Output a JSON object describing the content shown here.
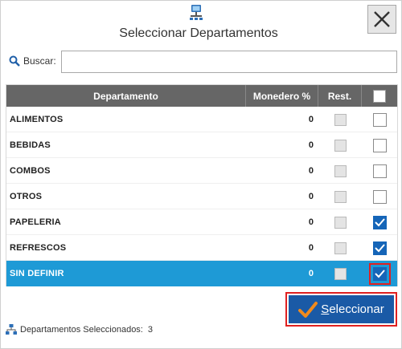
{
  "dialog": {
    "title": "Seleccionar Departamentos"
  },
  "search": {
    "label": "Buscar:",
    "value": "",
    "placeholder": ""
  },
  "grid": {
    "headers": {
      "department": "Departamento",
      "monedero": "Monedero %",
      "rest": "Rest."
    },
    "rows": [
      {
        "name": "ALIMENTOS",
        "monedero": "0",
        "rest": false,
        "selected": false
      },
      {
        "name": "BEBIDAS",
        "monedero": "0",
        "rest": false,
        "selected": false
      },
      {
        "name": "COMBOS",
        "monedero": "0",
        "rest": false,
        "selected": false
      },
      {
        "name": "OTROS",
        "monedero": "0",
        "rest": false,
        "selected": false
      },
      {
        "name": "PAPELERIA",
        "monedero": "0",
        "rest": false,
        "selected": true
      },
      {
        "name": "REFRESCOS",
        "monedero": "0",
        "rest": false,
        "selected": true
      },
      {
        "name": "SIN DEFINIR",
        "monedero": "0",
        "rest": false,
        "selected": true
      }
    ],
    "highlighted_row_index": 6
  },
  "footer": {
    "selected_label": "Departamentos Seleccionados:",
    "selected_count": "3",
    "button_label_first": "S",
    "button_label_rest": "eleccionar"
  },
  "colors": {
    "header_bg": "#666666",
    "selected_row": "#1e9ad6",
    "checkbox_checked": "#1565b8",
    "button_bg": "#1a5aa6",
    "highlight_border": "#e02020",
    "check_orange": "#f08a1c"
  },
  "icons": {
    "title": "network-computer-icon",
    "close": "close-icon",
    "search": "magnifier-icon",
    "footer": "hierarchy-icon",
    "button": "checkmark-icon"
  }
}
